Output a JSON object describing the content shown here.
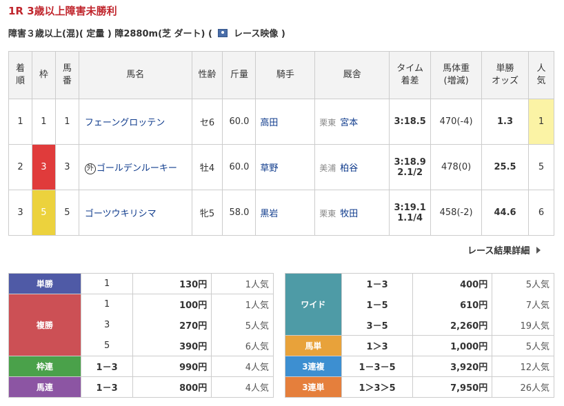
{
  "race": {
    "title": "1R 3歳以上障害未勝利",
    "info_before": "障害３歳以上(混)( 定量 ) 障2880m(芝 ダート)  (",
    "video_label": "レース映像",
    "info_after": ")"
  },
  "table": {
    "headers": {
      "rank": [
        "着",
        "順"
      ],
      "frame": "枠",
      "num": [
        "馬",
        "番"
      ],
      "name": "馬名",
      "sexage": "性齢",
      "weight": "斤量",
      "jockey": "騎手",
      "trainer": "厩舎",
      "time": [
        "タイム",
        "着差"
      ],
      "body": [
        "馬体重",
        "(増減)"
      ],
      "odds": [
        "単勝",
        "オッズ"
      ],
      "pop": [
        "人",
        "気"
      ]
    },
    "rows": [
      {
        "rank": "1",
        "frame": "1",
        "num": "1",
        "mark": "",
        "name": "フェーングロッテン",
        "sexage": "セ6",
        "weight": "60.0",
        "jockey": "高田",
        "region": "栗東",
        "trainer": "宮本",
        "time": "3:18.5",
        "margin": "",
        "body": "470(-4)",
        "odds": "1.3",
        "pop": "1"
      },
      {
        "rank": "2",
        "frame": "3",
        "num": "3",
        "mark": "外",
        "name": "ゴールデンルーキー",
        "sexage": "牡4",
        "weight": "60.0",
        "jockey": "草野",
        "region": "美浦",
        "trainer": "柏谷",
        "time": "3:18.9",
        "margin": "2.1/2",
        "body": "478(0)",
        "odds": "25.5",
        "pop": "5"
      },
      {
        "rank": "3",
        "frame": "5",
        "num": "5",
        "mark": "",
        "name": "ゴーツウキリシマ",
        "sexage": "牝5",
        "weight": "58.0",
        "jockey": "黒岩",
        "region": "栗東",
        "trainer": "牧田",
        "time": "3:19.1",
        "margin": "1.1/4",
        "body": "458(-2)",
        "odds": "44.6",
        "pop": "6"
      }
    ]
  },
  "detail_link": "レース結果詳細",
  "payouts_left": {
    "tansho": {
      "label": "単勝",
      "color": "#4f5aa6",
      "rows": [
        {
          "combo": "1",
          "payout": "130円",
          "pop": "1人気"
        }
      ]
    },
    "fukusho": {
      "label": "複勝",
      "color": "#cc5055",
      "rows": [
        {
          "combo": "1",
          "payout": "100円",
          "pop": "1人気"
        },
        {
          "combo": "3",
          "payout": "270円",
          "pop": "5人気"
        },
        {
          "combo": "5",
          "payout": "390円",
          "pop": "6人気"
        }
      ]
    },
    "wakuren": {
      "label": "枠連",
      "color": "#4aa14a",
      "rows": [
        {
          "combo": "1－3",
          "payout": "990円",
          "pop": "4人気"
        }
      ]
    },
    "umaren": {
      "label": "馬連",
      "color": "#8c55a3",
      "rows": [
        {
          "combo": "1－3",
          "payout": "800円",
          "pop": "4人気"
        }
      ]
    }
  },
  "payouts_right": {
    "wide": {
      "label": "ワイド",
      "color": "#4e9ba6",
      "rows": [
        {
          "combo": "1－3",
          "payout": "400円",
          "pop": "5人気"
        },
        {
          "combo": "1－5",
          "payout": "610円",
          "pop": "7人気"
        },
        {
          "combo": "3－5",
          "payout": "2,260円",
          "pop": "19人気"
        }
      ]
    },
    "umatan": {
      "label": "馬単",
      "color": "#e8a23a",
      "rows": [
        {
          "combo": "1＞3",
          "payout": "1,000円",
          "pop": "5人気"
        }
      ]
    },
    "sanrenpuku": {
      "label": "3連複",
      "color": "#3d8fd1",
      "rows": [
        {
          "combo": "1－3－5",
          "payout": "3,920円",
          "pop": "12人気"
        }
      ]
    },
    "sanrentan": {
      "label": "3連単",
      "color": "#e57f3c",
      "rows": [
        {
          "combo": "1＞3＞5",
          "payout": "7,950円",
          "pop": "26人気"
        }
      ]
    }
  }
}
